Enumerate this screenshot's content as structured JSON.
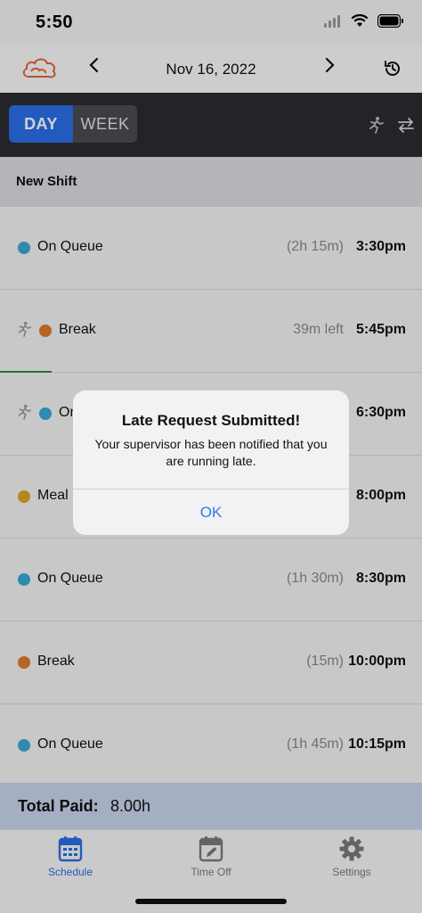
{
  "status_bar": {
    "time": "5:50"
  },
  "header": {
    "date": "Nov 16, 2022",
    "prev_icon": "chevron-left-icon",
    "next_icon": "chevron-right-icon",
    "history_icon": "history-icon"
  },
  "toolbar": {
    "day_label": "DAY",
    "week_label": "WEEK"
  },
  "shift": {
    "title": "New Shift"
  },
  "rows": [
    {
      "label": "On Queue",
      "duration": "(2h 15m)",
      "time": "3:30pm",
      "color": "#3aa9d8",
      "running": false
    },
    {
      "label": "Break",
      "duration": "39m left",
      "time": "5:45pm",
      "color": "#e07a2c",
      "running": true
    },
    {
      "label": "On Queue",
      "duration": "",
      "time": "6:30pm",
      "color": "#3aa9d8",
      "running": true
    },
    {
      "label": "Meal",
      "duration": "",
      "time": "8:00pm",
      "color": "#e0a526",
      "running": false
    },
    {
      "label": "On Queue",
      "duration": "(1h 30m)",
      "time": "8:30pm",
      "color": "#3aa9d8",
      "running": false
    },
    {
      "label": "Break",
      "duration": "(15m)",
      "time": "10:00pm",
      "color": "#e07a2c",
      "running": false
    },
    {
      "label": "On Queue",
      "duration": "(1h 45m)",
      "time": "10:15pm",
      "color": "#3aa9d8",
      "running": false
    }
  ],
  "total": {
    "label": "Total Paid:",
    "value": "8.00h"
  },
  "tabs": [
    {
      "label": "Schedule",
      "icon": "calendar-icon",
      "active": true
    },
    {
      "label": "Time Off",
      "icon": "calendar-edit-icon",
      "active": false
    },
    {
      "label": "Settings",
      "icon": "gear-icon",
      "active": false
    }
  ],
  "alert": {
    "title": "Late Request Submitted!",
    "message": "Your supervisor has been notified that you are running late.",
    "ok_label": "OK"
  },
  "colors": {
    "accent": "#2a6ee8",
    "toolbar": "#2b2d31",
    "progress": "#2f8a2f",
    "total_bar": "#c9d6ee"
  }
}
